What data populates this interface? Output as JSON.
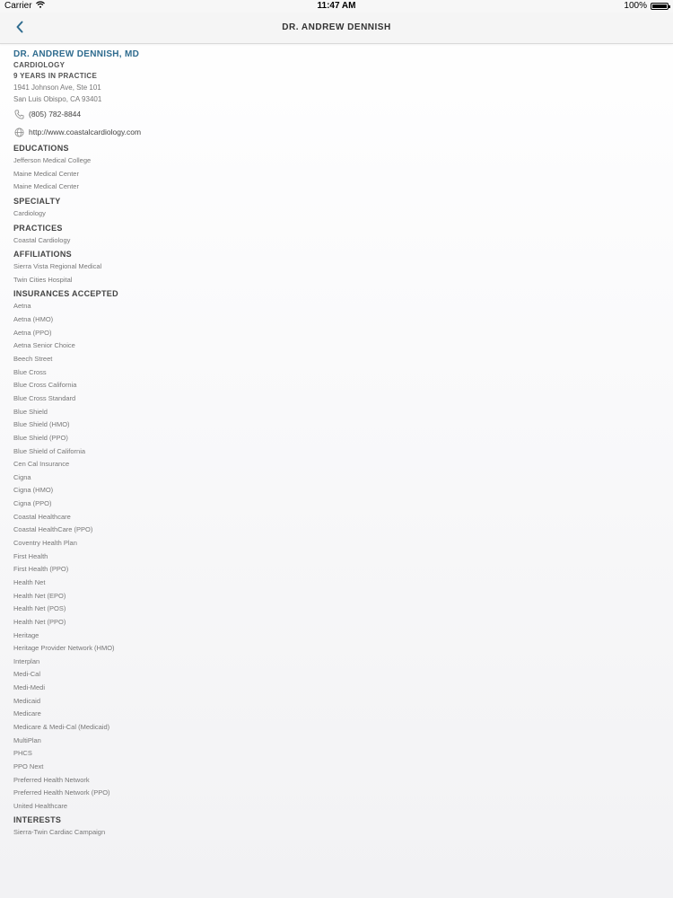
{
  "status": {
    "carrier": "Carrier",
    "time": "11:47 AM",
    "battery": "100%"
  },
  "nav": {
    "title": "DR. ANDREW DENNISH"
  },
  "doctor": {
    "name": "DR. ANDREW DENNISH, MD",
    "specialty_label": "CARDIOLOGY",
    "years": "9 YEARS IN PRACTICE",
    "address_line1": "1941 Johnson Ave, Ste 101",
    "address_line2": "San Luis Obispo, CA 93401",
    "phone": "(805) 782-8844",
    "website": "http://www.coastalcardiology.com"
  },
  "sections": {
    "educations": {
      "heading": "EDUCATIONS",
      "items": [
        "Jefferson Medical College",
        "Maine Medical Center",
        "Maine Medical Center"
      ]
    },
    "specialty": {
      "heading": "SPECIALTY",
      "items": [
        "Cardiology"
      ]
    },
    "practices": {
      "heading": "PRACTICES",
      "items": [
        "Coastal Cardiology"
      ]
    },
    "affiliations": {
      "heading": "AFFILIATIONS",
      "items": [
        "Sierra Vista Regional Medical",
        "Twin Cities Hospital"
      ]
    },
    "insurances": {
      "heading": "INSURANCES ACCEPTED",
      "items": [
        "Aetna",
        "Aetna (HMO)",
        "Aetna (PPO)",
        "Aetna Senior Choice",
        "Beech Street",
        "Blue Cross",
        "Blue Cross California",
        "Blue Cross Standard",
        "Blue Shield",
        "Blue Shield (HMO)",
        "Blue Shield (PPO)",
        "Blue Shield of California",
        "Cen Cal Insurance",
        "Cigna",
        "Cigna (HMO)",
        "Cigna (PPO)",
        "Coastal Healthcare",
        "Coastal HealthCare (PPO)",
        "Coventry Health Plan",
        "First Health",
        "First Health (PPO)",
        "Health Net",
        "Health Net (EPO)",
        "Health Net (POS)",
        "Health Net (PPO)",
        "Heritage",
        "Heritage Provider Network (HMO)",
        "Interplan",
        "Medi-Cal",
        "Medi-Medi",
        "Medicaid",
        "Medicare",
        "Medicare & Medi-Cal (Medicaid)",
        "MultiPlan",
        "PHCS",
        "PPO Next",
        "Preferred Health Network",
        "Preferred Health Network (PPO)",
        "United Healthcare"
      ]
    },
    "interests": {
      "heading": "INTERESTS",
      "items": [
        "Sierra-Twin Cardiac Campaign"
      ]
    }
  },
  "colors": {
    "accent": "#2f6c8f",
    "nav_bg": "#f5f5f5"
  },
  "icons": {
    "back": "chevron-left-icon",
    "phone": "phone-icon",
    "web": "globe-icon",
    "wifi": "wifi-icon",
    "battery": "battery-icon"
  }
}
